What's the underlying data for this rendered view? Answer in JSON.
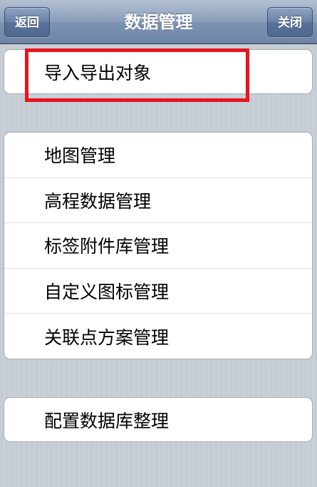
{
  "navbar": {
    "title": "数据管理",
    "back_label": "返回",
    "close_label": "关闭"
  },
  "sections": [
    {
      "items": [
        {
          "label": "导入导出对象"
        }
      ]
    },
    {
      "items": [
        {
          "label": "地图管理"
        },
        {
          "label": "高程数据管理"
        },
        {
          "label": "标签附件库管理"
        },
        {
          "label": "自定义图标管理"
        },
        {
          "label": "关联点方案管理"
        }
      ]
    },
    {
      "items": [
        {
          "label": "配置数据库整理"
        }
      ]
    }
  ],
  "colors": {
    "highlight": "#e8141e",
    "navbar": "#7d93b3",
    "background": "#c5ccd4"
  }
}
